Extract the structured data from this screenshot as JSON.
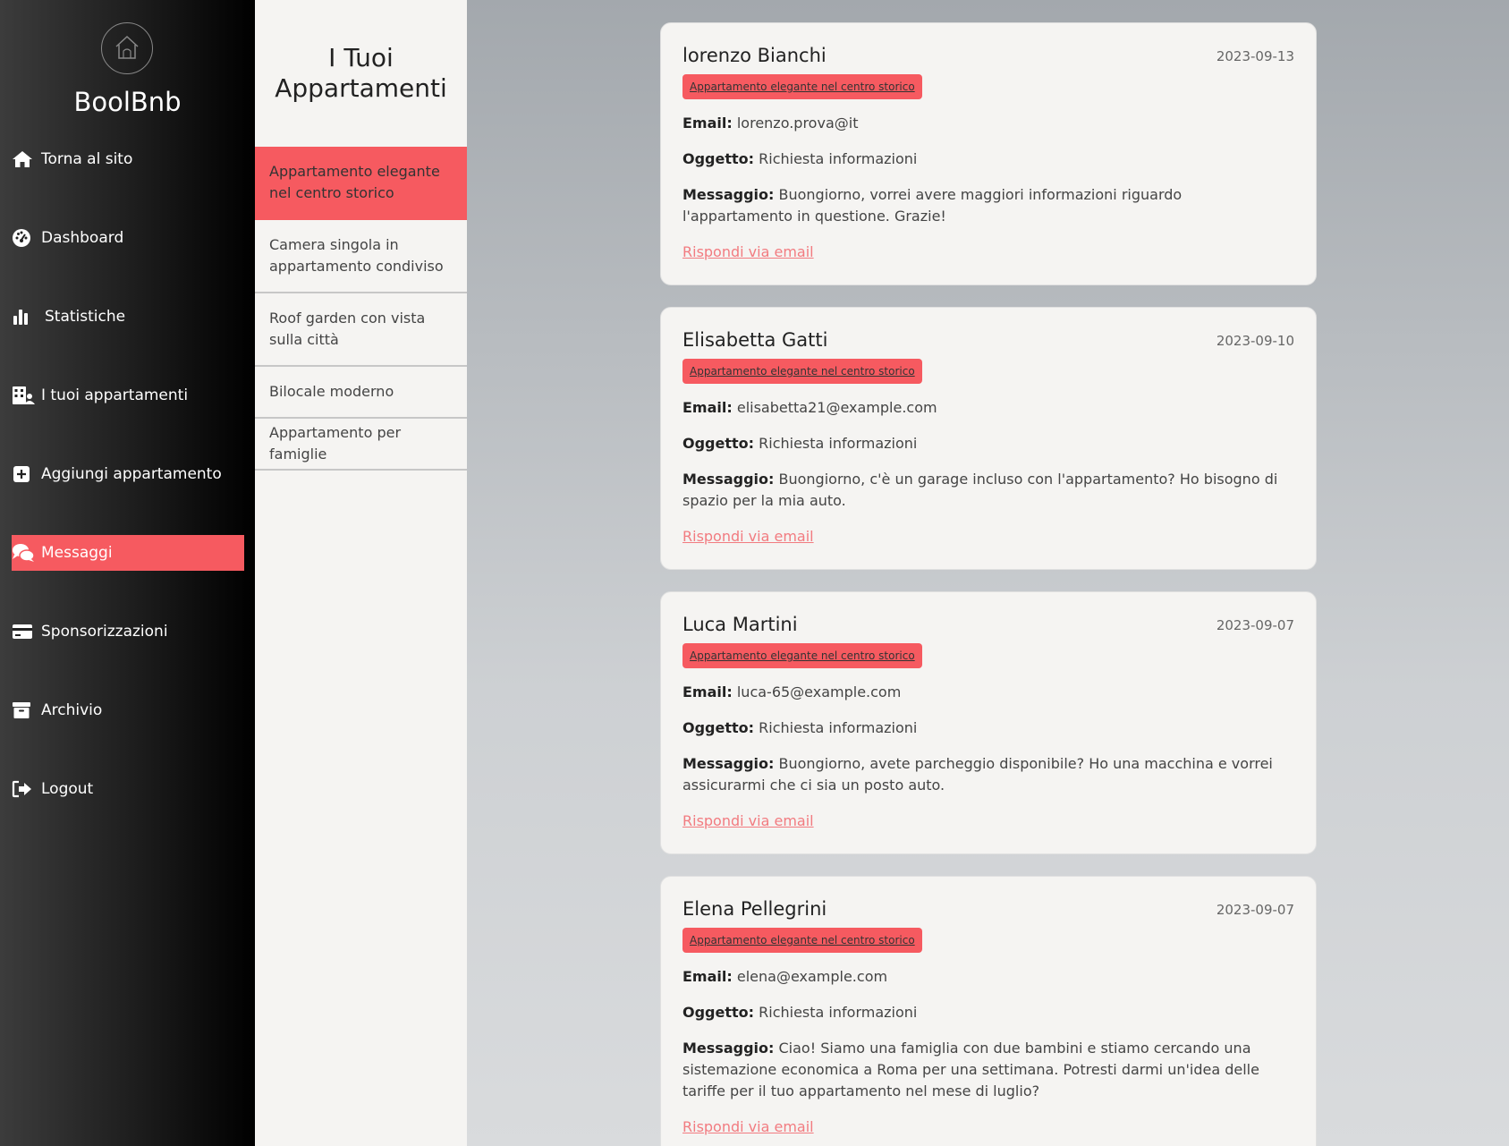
{
  "sidebar": {
    "brand": "BoolBnb",
    "items": [
      {
        "label": "Torna al sito",
        "icon": "home-icon"
      },
      {
        "label": "Dashboard",
        "icon": "gauge-icon"
      },
      {
        "label": "Statistiche",
        "icon": "bar-chart-icon"
      },
      {
        "label": "I tuoi appartamenti",
        "icon": "building-user-icon"
      },
      {
        "label": "Aggiungi appartamento",
        "icon": "plus-square-icon"
      },
      {
        "label": "Messaggi",
        "icon": "comments-icon",
        "active": true
      },
      {
        "label": "Sponsorizzazioni",
        "icon": "credit-card-icon"
      },
      {
        "label": "Archivio",
        "icon": "archive-icon"
      },
      {
        "label": "Logout",
        "icon": "logout-icon"
      }
    ]
  },
  "apartments": {
    "title_line1": "I Tuoi",
    "title_line2": "Appartamenti",
    "items": [
      {
        "label": "Appartamento elegante nel centro storico",
        "active": true
      },
      {
        "label": "Camera singola in appartamento condiviso"
      },
      {
        "label": "Roof garden con vista sulla città"
      },
      {
        "label": "Bilocale moderno"
      },
      {
        "label": "Appartamento per famiglie"
      }
    ]
  },
  "labels": {
    "email": "Email:",
    "subject": "Oggetto:",
    "message": "Messaggio:",
    "reply": "Rispondi via email"
  },
  "messages": [
    {
      "name": "lorenzo Bianchi",
      "date": "2023-09-13",
      "apartment": "Appartamento elegante nel centro storico",
      "email": "lorenzo.prova@it",
      "subject": "Richiesta informazioni",
      "body": "Buongiorno, vorrei avere maggiori informazioni riguardo l'appartamento in questione. Grazie!"
    },
    {
      "name": "Elisabetta Gatti",
      "date": "2023-09-10",
      "apartment": "Appartamento elegante nel centro storico",
      "email": "elisabetta21@example.com",
      "subject": "Richiesta informazioni",
      "body": "Buongiorno, c'è un garage incluso con l'appartamento? Ho bisogno di spazio per la mia auto."
    },
    {
      "name": "Luca Martini",
      "date": "2023-09-07",
      "apartment": "Appartamento elegante nel centro storico",
      "email": "luca-65@example.com",
      "subject": "Richiesta informazioni",
      "body": "Buongiorno, avete parcheggio disponibile? Ho una macchina e vorrei assicurarmi che ci sia un posto auto."
    },
    {
      "name": "Elena Pellegrini",
      "date": "2023-09-07",
      "apartment": "Appartamento elegante nel centro storico",
      "email": "elena@example.com",
      "subject": "Richiesta informazioni",
      "body": "Ciao! Siamo una famiglia con due bambini e stiamo cercando una sistemazione economica a Roma per una settimana. Potresti darmi un'idea delle tariffe per il tuo appartamento nel mese di luglio?"
    }
  ],
  "colors": {
    "accent": "#f65a60",
    "link": "#f27b80"
  }
}
